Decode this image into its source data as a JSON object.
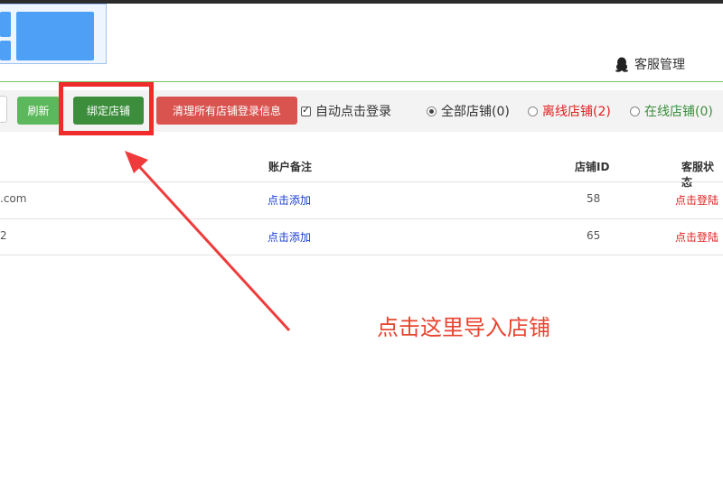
{
  "header": {
    "service_label": "客服管理"
  },
  "toolbar": {
    "refresh_label": "刷新",
    "bind_label": "绑定店铺",
    "clear_label": "清理所有店铺登录信息",
    "auto_login_label": "自动点击登录",
    "auto_login_checked": true,
    "filters": [
      {
        "label": "全部店铺(0)",
        "selected": true,
        "color": "#333333"
      },
      {
        "label": "离线店铺(2)",
        "selected": false,
        "color": "#e02020"
      },
      {
        "label": "在线店铺(0)",
        "selected": false,
        "color": "#3c8d3c"
      }
    ]
  },
  "table": {
    "headers": {
      "remark": "账户备注",
      "store_id": "店铺ID",
      "status": "客服状态"
    },
    "rows": [
      {
        "account": ".com",
        "remark": "点击添加",
        "store_id": "58",
        "status": "点击登陆"
      },
      {
        "account": "2",
        "remark": "点击添加",
        "store_id": "65",
        "status": "点击登陆"
      }
    ]
  },
  "annotation": {
    "text": "点击这里导入店铺",
    "color": "#e8432f"
  },
  "colors": {
    "highlight": "#ef2b2b",
    "bind_button": "#3c8d3c",
    "refresh_button": "#5cb85c",
    "clear_button": "#d9534f"
  }
}
